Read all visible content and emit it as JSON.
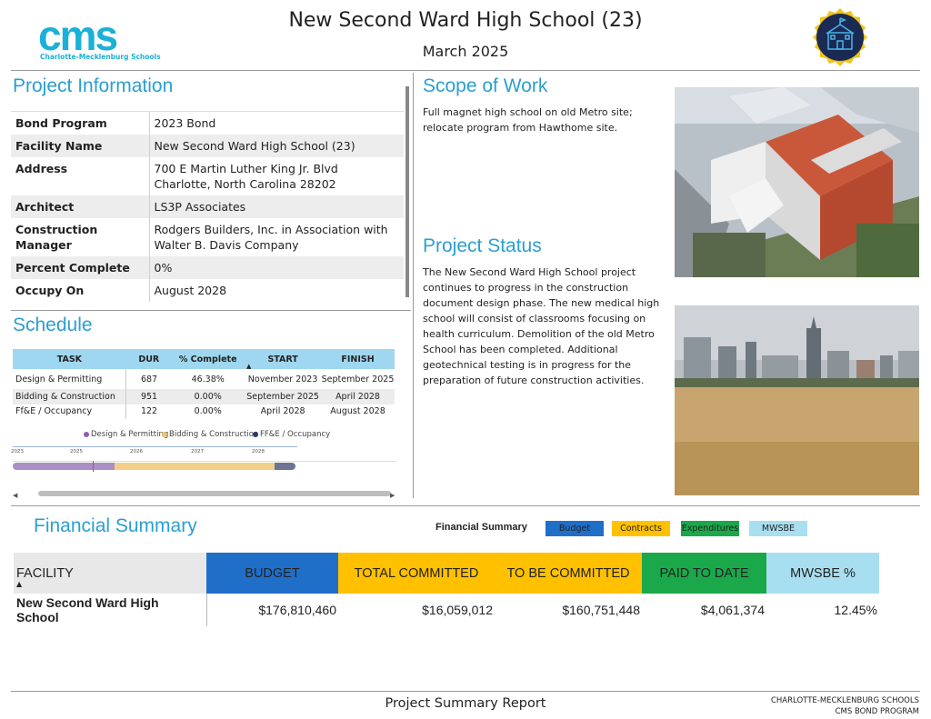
{
  "header": {
    "logo_word": "cms",
    "logo_sub": "Charlotte-Mecklenburg Schools",
    "title": "New Second Ward High School (23)",
    "date": "March 2025",
    "badge_icon": "school-building-icon"
  },
  "project_info": {
    "title": "Project Information",
    "rows": [
      {
        "label": "Bond Program",
        "value": "2023 Bond"
      },
      {
        "label": "Facility Name",
        "value": "New Second Ward High School (23)"
      },
      {
        "label": "Address",
        "value": "700 E Martin Luther King Jr. Blvd",
        "value2": "Charlotte, North Carolina 28202"
      },
      {
        "label": "Architect",
        "value": "LS3P Associates"
      },
      {
        "label": "Construction Manager",
        "value": "Rodgers Builders, Inc. in Association with",
        "value2": "Walter B. Davis Company"
      },
      {
        "label": "Percent Complete",
        "value": "0%"
      },
      {
        "label": "Occupy On",
        "value": "August 2028"
      }
    ]
  },
  "scope": {
    "title": "Scope of Work",
    "text": "Full magnet high school on old Metro site; relocate program from Hawthome site."
  },
  "status": {
    "title": "Project Status",
    "text": "The New Second Ward High School project continues to progress in the construction document design phase. The new medical high school will consist of classrooms focusing on health curriculum. Demolition of the old Metro School has been completed. Additional geotechnical testing is in progress for the preparation of future construction activities."
  },
  "schedule": {
    "title": "Schedule",
    "headers": [
      "TASK",
      "DUR",
      "% Complete",
      "START",
      "FINISH"
    ],
    "rows": [
      {
        "task": "Design & Permitting",
        "dur": "687",
        "pct": "46.38%",
        "start": "November 2023",
        "finish": "September 2025"
      },
      {
        "task": "Bidding & Construction",
        "dur": "951",
        "pct": "0.00%",
        "start": "September 2025",
        "finish": "April 2028"
      },
      {
        "task": "Ff&E / Occupancy",
        "dur": "122",
        "pct": "0.00%",
        "start": "April 2028",
        "finish": "August 2028"
      }
    ],
    "legend": [
      {
        "label": "Design & Permitting",
        "color": "#8e5fa8"
      },
      {
        "label": "Bidding & Construction",
        "color": "#f2c26a"
      },
      {
        "label": "FF&E / Occupancy",
        "color": "#2f3a6b"
      }
    ],
    "timeline_ticks": [
      "2023",
      "2025",
      "2026",
      "2027",
      "2028"
    ],
    "bars": [
      {
        "name": "Design & Permitting",
        "color": "#a98fc4"
      },
      {
        "name": "Bidding & Construction",
        "color": "#f4cf8a"
      },
      {
        "name": "FF&E / Occupancy",
        "color": "#6b7593"
      }
    ]
  },
  "financial": {
    "title": "Financial Summary",
    "legend_title": "Financial Summary",
    "legend": [
      {
        "label": "Budget",
        "color": "#1f6fc9"
      },
      {
        "label": "Contracts",
        "color": "#ffc000"
      },
      {
        "label": "Expenditures",
        "color": "#1aa84a"
      },
      {
        "label": "MWSBE",
        "color": "#a8dff0"
      }
    ],
    "headers": [
      "FACILITY",
      "BUDGET",
      "TOTAL COMMITTED",
      "TO BE COMMITTED",
      "PAID TO DATE",
      "MWSBE %"
    ],
    "row": [
      "New Second Ward High School",
      "$176,810,460",
      "$16,059,012",
      "$160,751,448",
      "$4,061,374",
      "12.45%"
    ]
  },
  "footer": {
    "title": "Project Summary Report",
    "org_line1": "CHARLOTTE-MECKLENBURG SCHOOLS",
    "org_line2": "CMS BOND PROGRAM"
  }
}
